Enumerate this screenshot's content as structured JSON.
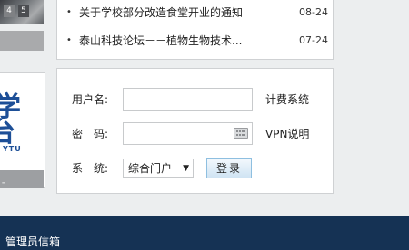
{
  "carousel": {
    "pages": [
      "4",
      "5"
    ]
  },
  "logo": {
    "char1": "学",
    "char2": "台",
    "abbr": "YTU"
  },
  "left_bottom": {
    "label": "」"
  },
  "news": [
    {
      "title": "关于学校部分改造食堂开业的通知",
      "date": "08-24"
    },
    {
      "title": "泰山科技论坛－－植物生物技术...",
      "date": "07-24"
    }
  ],
  "login": {
    "username_label": "用户名:",
    "username_value": "",
    "billing_link": "计费系统",
    "password_label": "密　码:",
    "password_value": "",
    "vpn_link": "VPN说明",
    "system_label": "系　统:",
    "system_selected": "综合门户",
    "login_button": "登录"
  },
  "footer": {
    "admin_mailbox": "管理员信箱"
  }
}
